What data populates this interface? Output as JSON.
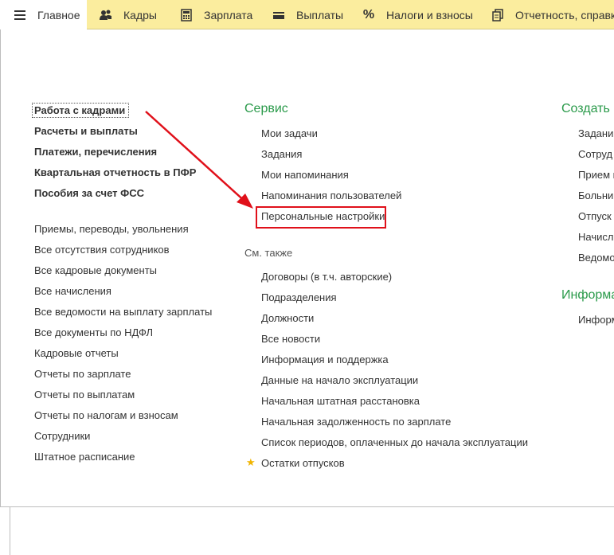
{
  "topbar": {
    "tabs": [
      {
        "label": "Главное",
        "icon": "menu-icon"
      },
      {
        "label": "Кадры",
        "icon": "people-icon"
      },
      {
        "label": "Зарплата",
        "icon": "calculator-icon"
      },
      {
        "label": "Выплаты",
        "icon": "wallet-icon"
      },
      {
        "label": "Налоги и взносы",
        "icon": "percent-icon",
        "glyph": "%"
      },
      {
        "label": "Отчетность, справки",
        "icon": "documents-icon"
      }
    ]
  },
  "left_column": {
    "bold_links": [
      "Работа с кадрами",
      "Расчеты и выплаты",
      "Платежи, перечисления",
      "Квартальная отчетность в ПФР",
      "Пособия за счет ФСС"
    ],
    "links": [
      "Приемы, переводы, увольнения",
      "Все отсутствия сотрудников",
      "Все кадровые документы",
      "Все начисления",
      "Все ведомости на выплату зарплаты",
      "Все документы по НДФЛ",
      "Кадровые отчеты",
      "Отчеты по зарплате",
      "Отчеты по выплатам",
      "Отчеты по налогам и взносам",
      "Сотрудники",
      "Штатное расписание"
    ]
  },
  "service": {
    "title": "Сервис",
    "links": [
      "Мои задачи",
      "Задания",
      "Мои напоминания",
      "Напоминания пользователей",
      "Персональные настройки"
    ]
  },
  "see_also": {
    "title": "См. также",
    "links": [
      "Договоры (в т.ч. авторские)",
      "Подразделения",
      "Должности",
      "Все новости",
      "Информация и поддержка",
      "Данные на начало эксплуатации",
      "Начальная штатная расстановка",
      "Начальная задолженность по зарплате",
      "Список периодов, оплаченных до начала эксплуатации",
      "Остатки отпусков"
    ]
  },
  "create": {
    "title": "Создать",
    "links": [
      "Задани",
      "Сотруд",
      "Прием н",
      "Больни",
      "Отпуск",
      "Начисл",
      "Ведомо"
    ]
  },
  "info": {
    "title": "Информа",
    "links": [
      "Информ"
    ]
  },
  "colors": {
    "topbar_bg": "#fbed9e",
    "section_header": "#2a9a4a",
    "highlight": "#e0101a",
    "favorite_star": "#f0b400"
  }
}
